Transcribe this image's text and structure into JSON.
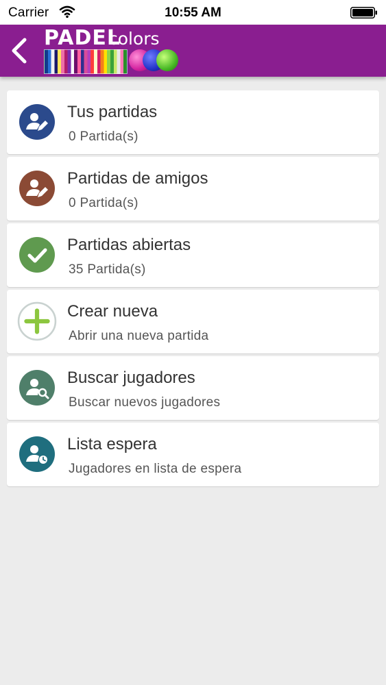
{
  "status_bar": {
    "carrier": "Carrier",
    "time": "10:55 AM"
  },
  "header": {
    "logo_word": "PADEL",
    "logo_suffix": "colors",
    "background_color": "#8a1e90"
  },
  "menu": {
    "items": [
      {
        "title": "Tus partidas",
        "subtitle": "0 Partida(s)",
        "icon": "user-edit-icon",
        "icon_color": "#2b4a8c"
      },
      {
        "title": "Partidas de amigos",
        "subtitle": "0 Partida(s)",
        "icon": "user-edit-icon",
        "icon_color": "#8b4a35"
      },
      {
        "title": "Partidas abiertas",
        "subtitle": "35 Partida(s)",
        "icon": "check-icon",
        "icon_color": "#5f9a4f"
      },
      {
        "title": "Crear nueva",
        "subtitle": "Abrir una nueva partida",
        "icon": "plus-icon",
        "icon_color": "#8cc63f"
      },
      {
        "title": "Buscar jugadores",
        "subtitle": "Buscar nuevos jugadores",
        "icon": "user-search-icon",
        "icon_color": "#4f7f6a"
      },
      {
        "title": "Lista espera",
        "subtitle": "Jugadores en lista de espera",
        "icon": "user-clock-icon",
        "icon_color": "#1f6e7e"
      }
    ]
  }
}
